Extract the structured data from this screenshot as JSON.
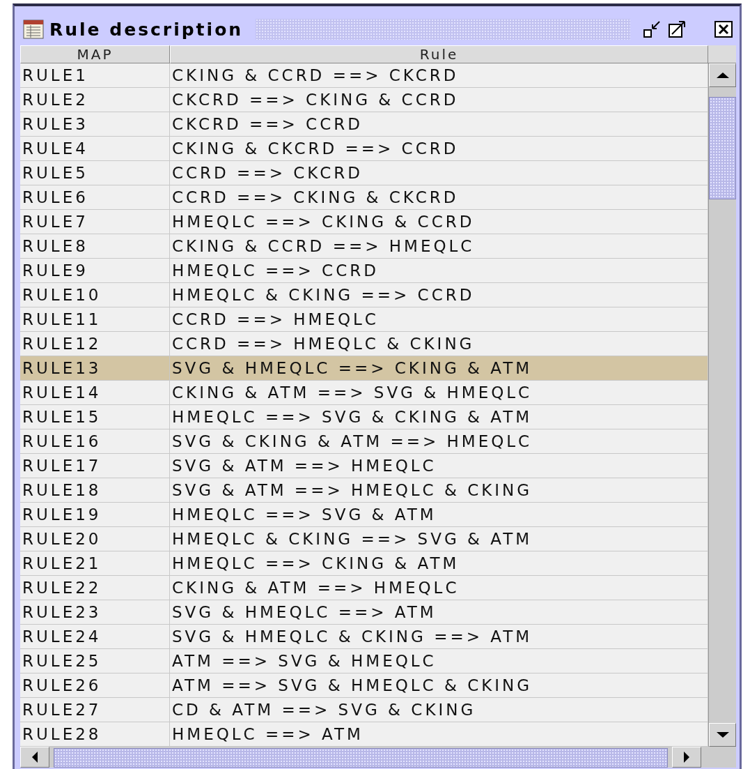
{
  "window": {
    "title": "Rule description"
  },
  "table": {
    "columns": [
      "MAP",
      "Rule"
    ],
    "rows": [
      {
        "map": "RULE1",
        "rule": "CKING & CCRD ==> CKCRD",
        "selected": false
      },
      {
        "map": "RULE2",
        "rule": "CKCRD ==> CKING & CCRD",
        "selected": false
      },
      {
        "map": "RULE3",
        "rule": "CKCRD ==> CCRD",
        "selected": false
      },
      {
        "map": "RULE4",
        "rule": "CKING & CKCRD ==> CCRD",
        "selected": false
      },
      {
        "map": "RULE5",
        "rule": "CCRD ==> CKCRD",
        "selected": false
      },
      {
        "map": "RULE6",
        "rule": "CCRD ==> CKING & CKCRD",
        "selected": false
      },
      {
        "map": "RULE7",
        "rule": "HMEQLC ==> CKING & CCRD",
        "selected": false
      },
      {
        "map": "RULE8",
        "rule": "CKING & CCRD ==> HMEQLC",
        "selected": false
      },
      {
        "map": "RULE9",
        "rule": "HMEQLC ==> CCRD",
        "selected": false
      },
      {
        "map": "RULE10",
        "rule": "HMEQLC & CKING ==> CCRD",
        "selected": false
      },
      {
        "map": "RULE11",
        "rule": "CCRD ==> HMEQLC",
        "selected": false
      },
      {
        "map": "RULE12",
        "rule": "CCRD ==> HMEQLC & CKING",
        "selected": false
      },
      {
        "map": "RULE13",
        "rule": "SVG & HMEQLC ==> CKING & ATM",
        "selected": true
      },
      {
        "map": "RULE14",
        "rule": "CKING & ATM ==> SVG & HMEQLC",
        "selected": false
      },
      {
        "map": "RULE15",
        "rule": "HMEQLC ==> SVG & CKING & ATM",
        "selected": false
      },
      {
        "map": "RULE16",
        "rule": "SVG & CKING & ATM ==> HMEQLC",
        "selected": false
      },
      {
        "map": "RULE17",
        "rule": "SVG & ATM ==> HMEQLC",
        "selected": false
      },
      {
        "map": "RULE18",
        "rule": "SVG & ATM ==> HMEQLC & CKING",
        "selected": false
      },
      {
        "map": "RULE19",
        "rule": "HMEQLC ==> SVG & ATM",
        "selected": false
      },
      {
        "map": "RULE20",
        "rule": "HMEQLC & CKING ==> SVG & ATM",
        "selected": false
      },
      {
        "map": "RULE21",
        "rule": "HMEQLC ==> CKING & ATM",
        "selected": false
      },
      {
        "map": "RULE22",
        "rule": "CKING & ATM ==> HMEQLC",
        "selected": false
      },
      {
        "map": "RULE23",
        "rule": "SVG & HMEQLC ==> ATM",
        "selected": false
      },
      {
        "map": "RULE24",
        "rule": "SVG & HMEQLC & CKING ==> ATM",
        "selected": false
      },
      {
        "map": "RULE25",
        "rule": "ATM ==> SVG & HMEQLC",
        "selected": false
      },
      {
        "map": "RULE26",
        "rule": "ATM ==> SVG & HMEQLC & CKING",
        "selected": false
      },
      {
        "map": "RULE27",
        "rule": "CD & ATM ==> SVG & CKING",
        "selected": false
      },
      {
        "map": "RULE28",
        "rule": "HMEQLC ==> ATM",
        "selected": false
      }
    ]
  }
}
